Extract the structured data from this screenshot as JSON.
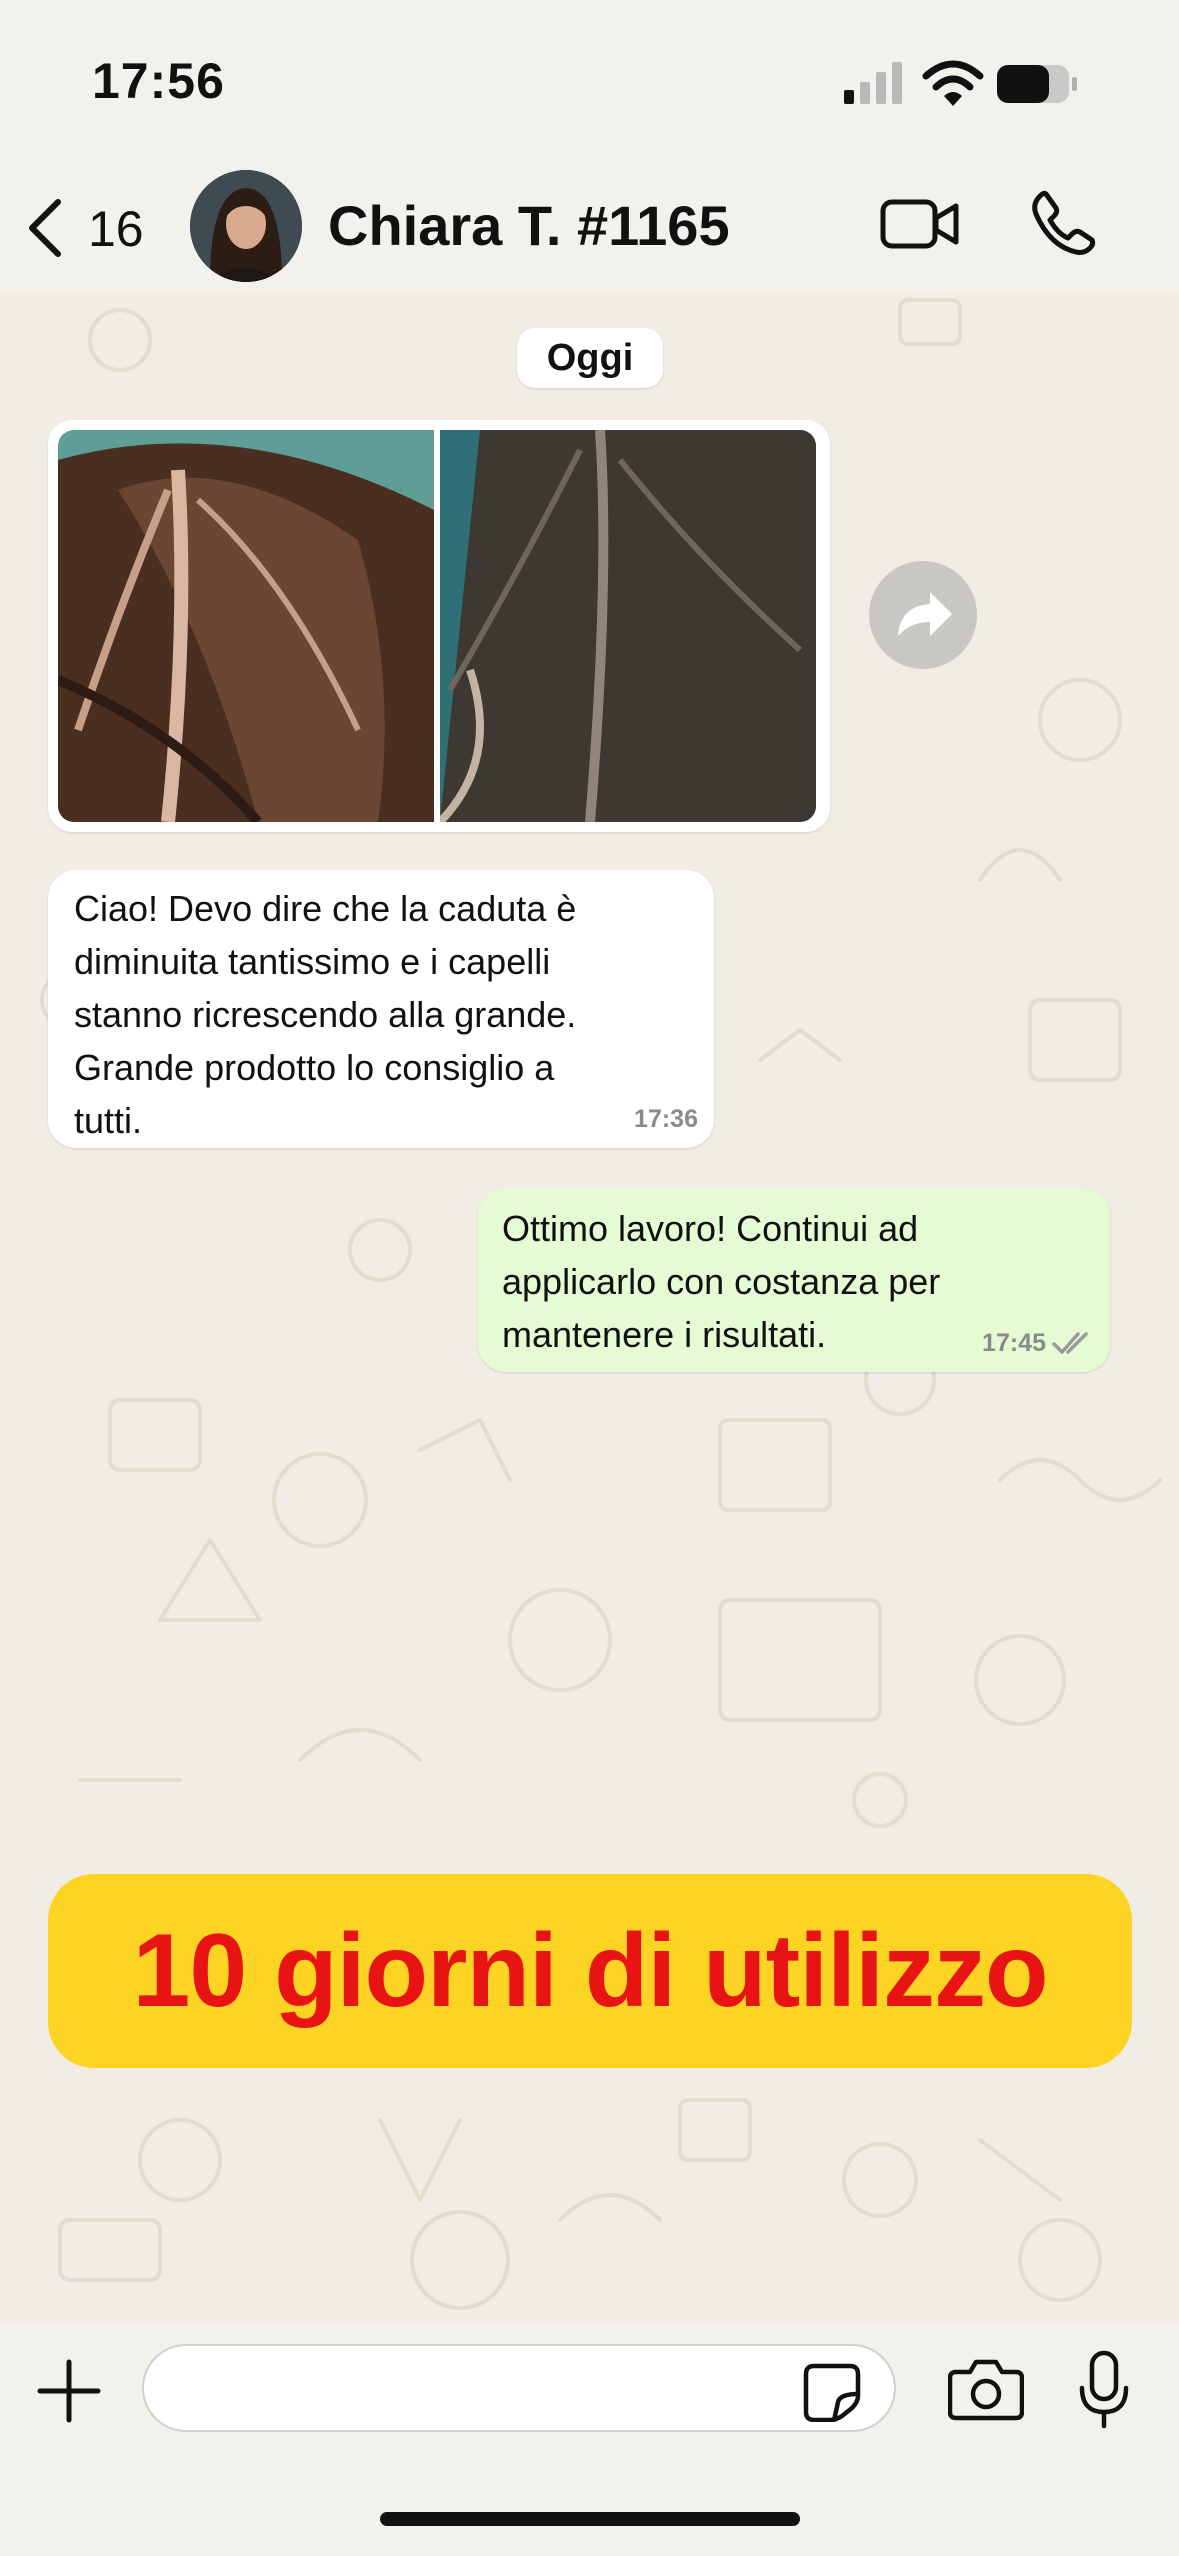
{
  "status_bar": {
    "time": "17:56",
    "icons": [
      "signal-icon",
      "wifi-icon",
      "battery-icon"
    ]
  },
  "header": {
    "back_count": "16",
    "contact_name": "Chiara T. #1165",
    "icons": [
      "back-chevron-icon",
      "video-call-icon",
      "phone-call-icon"
    ]
  },
  "chat": {
    "date_label": "Oggi",
    "messages": [
      {
        "type": "image",
        "direction": "incoming",
        "description_icon": "hair-before-after-photo"
      },
      {
        "type": "text",
        "direction": "incoming",
        "lines": [
          "Ciao! Devo dire che la caduta è",
          "diminuita tantissimo e i capelli",
          "stanno ricrescendo alla grande.",
          "Grande prodotto lo consiglio a",
          "tutti."
        ],
        "time": "17:36"
      },
      {
        "type": "text",
        "direction": "outgoing",
        "lines": [
          "Ottimo lavoro! Continui ad",
          "applicarlo con costanza per",
          "mantenere i risultati."
        ],
        "time": "17:45",
        "status": "read"
      }
    ]
  },
  "banner": {
    "text": "10 giorni di utilizzo",
    "background": "#fdd423",
    "text_color": "#e81313"
  },
  "input_bar": {
    "message_value": "",
    "icons": [
      "plus-icon",
      "sticker-icon",
      "camera-icon",
      "microphone-icon"
    ]
  },
  "colors": {
    "outgoing_bubble": "#e5fbd4",
    "incoming_bubble": "#ffffff",
    "wallpaper": "#f1ede4"
  }
}
